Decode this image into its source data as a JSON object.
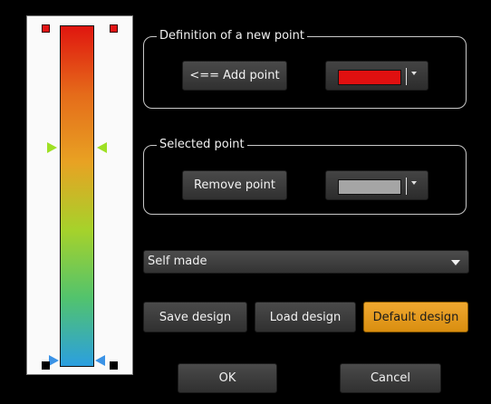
{
  "gradient": {
    "colors": [
      "#e0160f",
      "#e56b1a",
      "#e8a223",
      "#a6d22b",
      "#52c36d",
      "#2b9fe0"
    ],
    "points": [
      {
        "position": 0.0,
        "color": "#e31313"
      },
      {
        "position": 0.36,
        "color": "#8ed12b"
      },
      {
        "position": 1.0,
        "color": "#2a97e6"
      }
    ],
    "marker_colors": {
      "mid": "#9ee024",
      "bottom": "#3b93e6"
    }
  },
  "new_point": {
    "title": "Definition of a new point",
    "add_label": "<== Add point",
    "color": "#e01010"
  },
  "selected_point": {
    "title": "Selected point",
    "remove_label": "Remove point",
    "color": "#a5a5a5"
  },
  "design_select": {
    "value": "Self made"
  },
  "design_buttons": {
    "save": "Save design",
    "load": "Load design",
    "default": "Default design"
  },
  "footer": {
    "ok": "OK",
    "cancel": "Cancel"
  }
}
